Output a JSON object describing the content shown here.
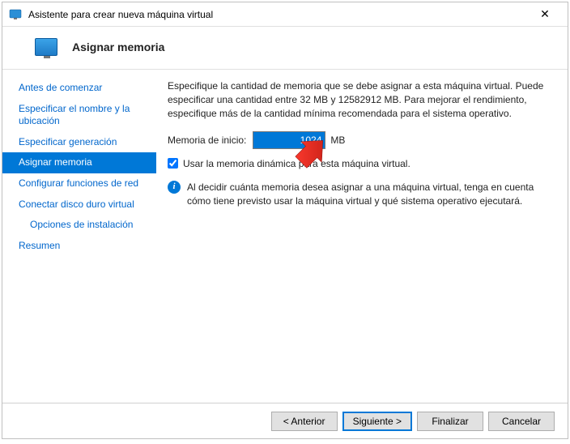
{
  "window": {
    "title": "Asistente para crear nueva máquina virtual"
  },
  "header": {
    "title": "Asignar memoria"
  },
  "sidebar": {
    "items": [
      {
        "label": "Antes de comenzar"
      },
      {
        "label": "Especificar el nombre y la ubicación"
      },
      {
        "label": "Especificar generación"
      },
      {
        "label": "Asignar memoria"
      },
      {
        "label": "Configurar funciones de red"
      },
      {
        "label": "Conectar disco duro virtual"
      },
      {
        "label": "Opciones de instalación"
      },
      {
        "label": "Resumen"
      }
    ]
  },
  "main": {
    "description": "Especifique la cantidad de memoria que se debe asignar a esta máquina virtual. Puede especificar una cantidad entre 32 MB y 12582912 MB. Para mejorar el rendimiento, especifique más de la cantidad mínima recomendada para el sistema operativo.",
    "memory_label": "Memoria de inicio:",
    "memory_value": "1024",
    "memory_units": "MB",
    "dynamic_label": "Usar la memoria dinámica para esta máquina virtual.",
    "info_text": "Al decidir cuánta memoria desea asignar a una máquina virtual, tenga en cuenta cómo tiene previsto usar la máquina virtual y qué sistema operativo ejecutará."
  },
  "buttons": {
    "prev": "< Anterior",
    "next": "Siguiente >",
    "finish": "Finalizar",
    "cancel": "Cancelar"
  }
}
